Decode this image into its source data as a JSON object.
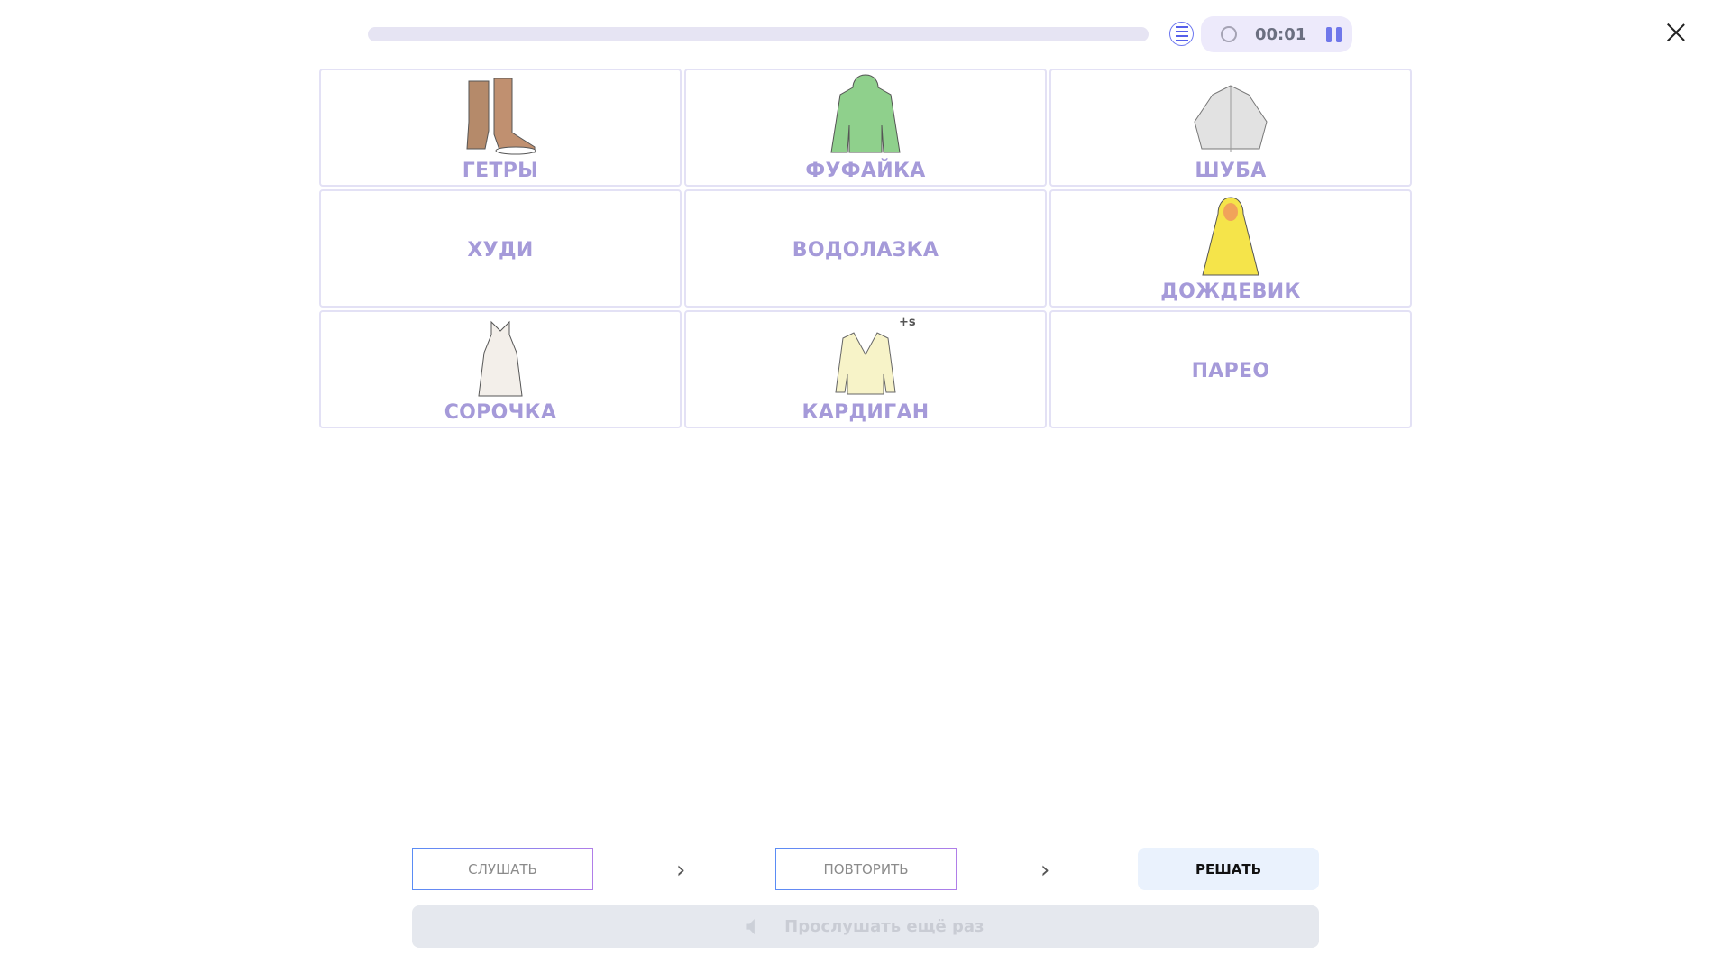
{
  "header": {
    "progress_percent": 0,
    "timer": "00:01"
  },
  "cards": [
    {
      "label": "ГЕТРЫ",
      "image": "boots"
    },
    {
      "label": "ФУФАЙКА",
      "image": "green-hoodie"
    },
    {
      "label": "ШУБА",
      "image": "fur-coat"
    },
    {
      "label": "ХУДИ",
      "image": ""
    },
    {
      "label": "ВОДОЛАЗКА",
      "image": ""
    },
    {
      "label": "ДОЖДЕВИК",
      "image": "yellow-raincoat"
    },
    {
      "label": "СОРОЧКА",
      "image": "nightgown"
    },
    {
      "label": "КАРДИГАН",
      "image": "cardigan",
      "badge": "+s"
    },
    {
      "label": "ПАРЕО",
      "image": ""
    }
  ],
  "steps": {
    "listen": "СЛУШАТЬ",
    "repeat": "ПОВТОРИТЬ",
    "solve": "РЕШАТЬ"
  },
  "replay_label": "Прослушать ещё раз",
  "colors": {
    "accent": "#6f77ea",
    "label": "#a59ad9",
    "solve_bg": "#eaf2fd"
  }
}
